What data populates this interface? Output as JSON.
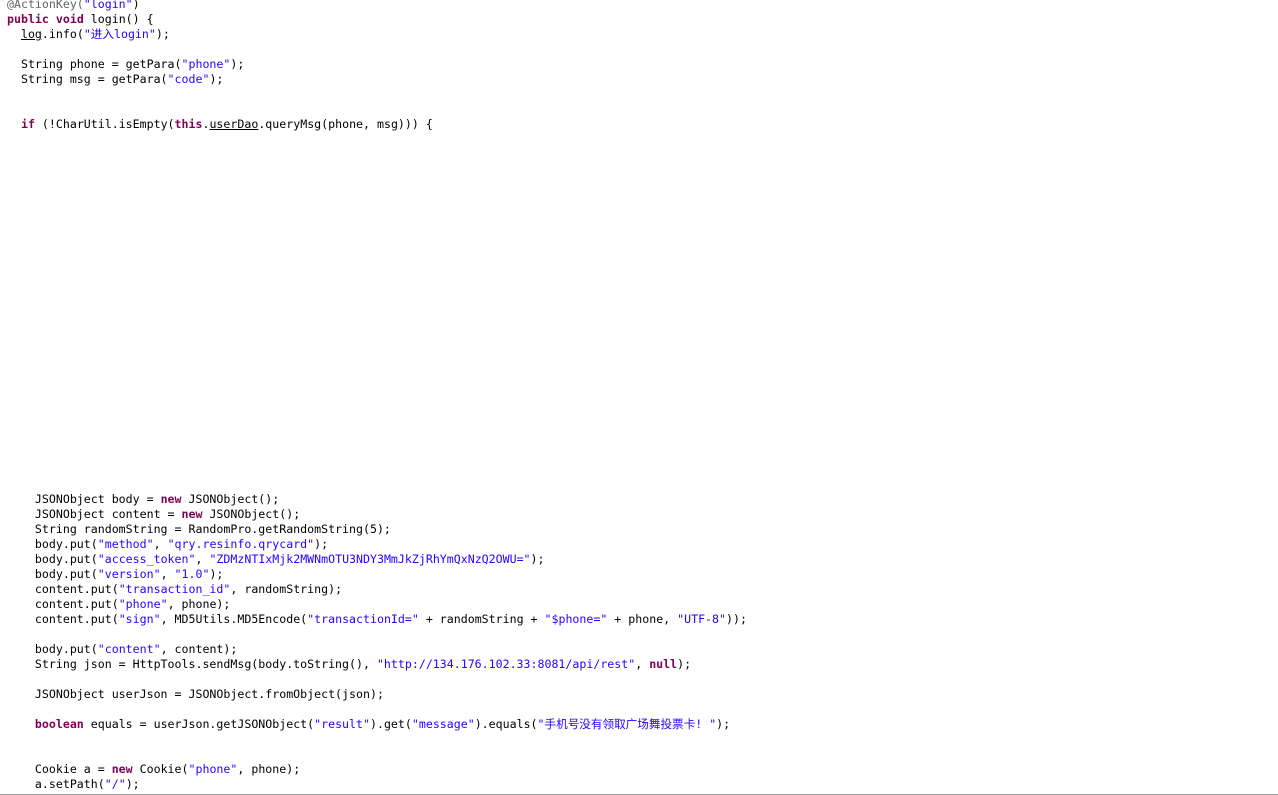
{
  "editor": {
    "colors": {
      "keyword": "#7f0055",
      "string": "#2a00ff",
      "annotation": "#646464",
      "plain": "#000000",
      "background": "#ffffff"
    },
    "lines": [
      {
        "tokens": [
          {
            "t": "@ActionKey(",
            "k": "annotation"
          },
          {
            "t": "\"login\"",
            "k": "string"
          },
          {
            "t": ")",
            "k": "plain"
          }
        ]
      },
      {
        "tokens": [
          {
            "t": "public",
            "k": "keyword"
          },
          {
            "t": " ",
            "k": "plain"
          },
          {
            "t": "void",
            "k": "keyword"
          },
          {
            "t": " login() {",
            "k": "plain"
          }
        ]
      },
      {
        "tokens": [
          {
            "t": "  ",
            "k": "plain"
          },
          {
            "t": "log",
            "k": "underline"
          },
          {
            "t": ".info(",
            "k": "plain"
          },
          {
            "t": "\"进入login\"",
            "k": "string"
          },
          {
            "t": ");",
            "k": "plain"
          }
        ]
      },
      {
        "tokens": [
          {
            "t": "  String phone = getPara(",
            "k": "plain"
          },
          {
            "t": "\"phone\"",
            "k": "string"
          },
          {
            "t": ");",
            "k": "plain"
          }
        ]
      },
      {
        "tokens": [
          {
            "t": "  String msg = getPara(",
            "k": "plain"
          },
          {
            "t": "\"code\"",
            "k": "string"
          },
          {
            "t": ");",
            "k": "plain"
          }
        ]
      },
      {
        "tokens": [
          {
            "t": "  ",
            "k": "plain"
          },
          {
            "t": "if",
            "k": "keyword"
          },
          {
            "t": " (!CharUtil.isEmpty(",
            "k": "plain"
          },
          {
            "t": "this",
            "k": "keyword"
          },
          {
            "t": ".",
            "k": "plain"
          },
          {
            "t": "userDao",
            "k": "underline"
          },
          {
            "t": ".queryMsg(phone, msg))) {",
            "k": "plain"
          }
        ]
      },
      {
        "tokens": [
          {
            "t": "    JSONObject body = ",
            "k": "plain"
          },
          {
            "t": "new",
            "k": "keyword"
          },
          {
            "t": " JSONObject();",
            "k": "plain"
          }
        ]
      },
      {
        "tokens": [
          {
            "t": "    JSONObject content = ",
            "k": "plain"
          },
          {
            "t": "new",
            "k": "keyword"
          },
          {
            "t": " JSONObject();",
            "k": "plain"
          }
        ]
      },
      {
        "tokens": [
          {
            "t": "    String randomString = RandomPro.getRandomString(5);",
            "k": "plain"
          }
        ]
      },
      {
        "tokens": [
          {
            "t": "    body.put(",
            "k": "plain"
          },
          {
            "t": "\"method\"",
            "k": "string"
          },
          {
            "t": ", ",
            "k": "plain"
          },
          {
            "t": "\"qry.resinfo.qrycard\"",
            "k": "string"
          },
          {
            "t": ");",
            "k": "plain"
          }
        ]
      },
      {
        "tokens": [
          {
            "t": "    body.put(",
            "k": "plain"
          },
          {
            "t": "\"access_token\"",
            "k": "string"
          },
          {
            "t": ", ",
            "k": "plain"
          },
          {
            "t": "\"ZDMzNTIxMjk2MWNmOTU3NDY3MmJkZjRhYmQxNzQ2OWU=\"",
            "k": "string"
          },
          {
            "t": ");",
            "k": "plain"
          }
        ]
      },
      {
        "tokens": [
          {
            "t": "    body.put(",
            "k": "plain"
          },
          {
            "t": "\"version\"",
            "k": "string"
          },
          {
            "t": ", ",
            "k": "plain"
          },
          {
            "t": "\"1.0\"",
            "k": "string"
          },
          {
            "t": ");",
            "k": "plain"
          }
        ]
      },
      {
        "tokens": [
          {
            "t": "    content.put(",
            "k": "plain"
          },
          {
            "t": "\"transaction_id\"",
            "k": "string"
          },
          {
            "t": ", randomString);",
            "k": "plain"
          }
        ]
      },
      {
        "tokens": [
          {
            "t": "    content.put(",
            "k": "plain"
          },
          {
            "t": "\"phone\"",
            "k": "string"
          },
          {
            "t": ", phone);",
            "k": "plain"
          }
        ]
      },
      {
        "tokens": [
          {
            "t": "    content.put(",
            "k": "plain"
          },
          {
            "t": "\"sign\"",
            "k": "string"
          },
          {
            "t": ", MD5Utils.MD5Encode(",
            "k": "plain"
          },
          {
            "t": "\"transactionId=\"",
            "k": "string"
          },
          {
            "t": " + randomString + ",
            "k": "plain"
          },
          {
            "t": "\"$phone=\"",
            "k": "string"
          },
          {
            "t": " + phone, ",
            "k": "plain"
          },
          {
            "t": "\"UTF-8\"",
            "k": "string"
          },
          {
            "t": "));",
            "k": "plain"
          }
        ]
      },
      {
        "tokens": [
          {
            "t": "    body.put(",
            "k": "plain"
          },
          {
            "t": "\"content\"",
            "k": "string"
          },
          {
            "t": ", content);",
            "k": "plain"
          }
        ]
      },
      {
        "tokens": [
          {
            "t": "    String json = HttpTools.sendMsg(body.toString(), ",
            "k": "plain"
          },
          {
            "t": "\"http://134.176.102.33:8081/api/rest\"",
            "k": "string"
          },
          {
            "t": ", ",
            "k": "plain"
          },
          {
            "t": "null",
            "k": "keyword"
          },
          {
            "t": ");",
            "k": "plain"
          }
        ]
      },
      {
        "tokens": [
          {
            "t": "    JSONObject userJson = JSONObject.fromObject(json);",
            "k": "plain"
          }
        ]
      },
      {
        "tokens": [
          {
            "t": "    ",
            "k": "plain"
          },
          {
            "t": "boolean",
            "k": "keyword"
          },
          {
            "t": " equals = userJson.getJSONObject(",
            "k": "plain"
          },
          {
            "t": "\"result\"",
            "k": "string"
          },
          {
            "t": ").get(",
            "k": "plain"
          },
          {
            "t": "\"message\"",
            "k": "string"
          },
          {
            "t": ").equals(",
            "k": "plain"
          },
          {
            "t": "\"手机号没有领取广场舞投票卡! \"",
            "k": "string"
          },
          {
            "t": ");",
            "k": "plain"
          }
        ]
      },
      {
        "tokens": [
          {
            "t": "    Cookie a = ",
            "k": "plain"
          },
          {
            "t": "new",
            "k": "keyword"
          },
          {
            "t": " Cookie(",
            "k": "plain"
          },
          {
            "t": "\"phone\"",
            "k": "string"
          },
          {
            "t": ", phone);",
            "k": "plain"
          }
        ]
      },
      {
        "tokens": [
          {
            "t": "    a.setPath(",
            "k": "plain"
          },
          {
            "t": "\"/\"",
            "k": "string"
          },
          {
            "t": ");",
            "k": "plain"
          }
        ]
      }
    ]
  }
}
